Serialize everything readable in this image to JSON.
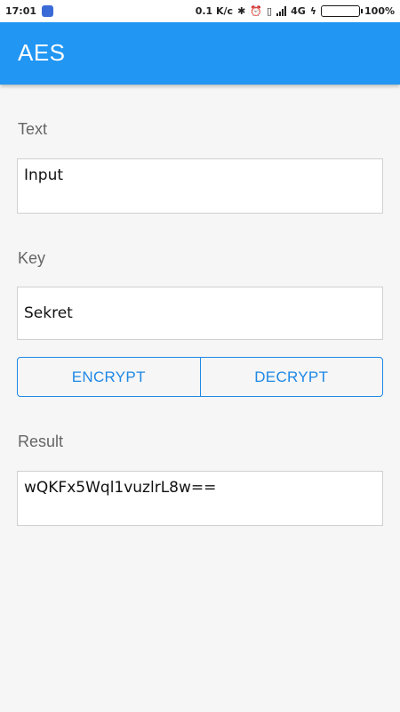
{
  "status_bar": {
    "time": "17:01",
    "notification_icon": "app-notification-icon",
    "network_speed": "0.1 K/c",
    "icons": [
      "bluetooth-icon",
      "alarm-icon",
      "vibrate-icon",
      "signal-icon"
    ],
    "network_type": "4G",
    "charging_icon": "lightning-icon",
    "battery_level": 1.0,
    "battery_percent": "100%"
  },
  "app_bar": {
    "title": "AES",
    "color": "#2196f3"
  },
  "text_section": {
    "label": "Text",
    "value": "Input"
  },
  "key_section": {
    "label": "Key",
    "value": "Sekret"
  },
  "actions": {
    "encrypt_label": "ENCRYPT",
    "decrypt_label": "DECRYPT",
    "accent_color": "#1e88e5"
  },
  "result_section": {
    "label": "Result",
    "value": "wQKFx5Wql1vuzlrL8w=="
  }
}
